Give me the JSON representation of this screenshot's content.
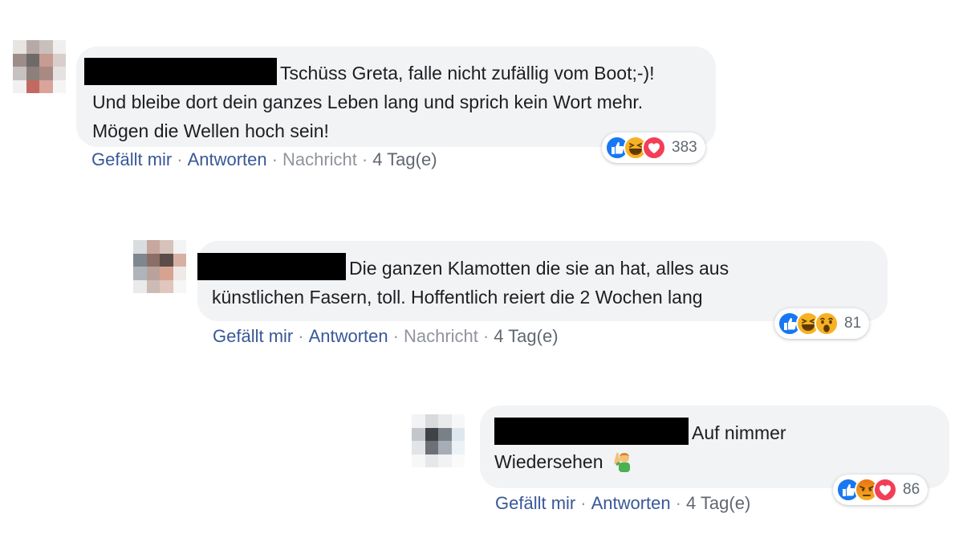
{
  "comments": [
    {
      "text_line1": "Tschüss Greta, falle nicht zufällig vom Boot;-)!",
      "text_line2": "Und bleibe dort dein ganzes Leben lang und sprich kein Wort mehr.",
      "text_line3": "Mögen die Wellen hoch sein!",
      "like": "Gefällt mir",
      "reply": "Antworten",
      "message": "Nachricht",
      "time": "4 Tag(e)",
      "reactions": [
        "like-icon",
        "haha-icon",
        "love-icon"
      ],
      "reaction_count": "383"
    },
    {
      "text_line1": "Die ganzen Klamotten die sie an hat, alles aus",
      "text_line2": "künstlichen Fasern, toll. Hoffentlich reiert die 2 Wochen lang",
      "like": "Gefällt mir",
      "reply": "Antworten",
      "message": "Nachricht",
      "time": "4 Tag(e)",
      "reactions": [
        "like-icon",
        "haha-icon",
        "wow-icon"
      ],
      "reaction_count": "81"
    },
    {
      "text_line1": "Auf nimmer",
      "text_line2": "Wiedersehen",
      "like": "Gefällt mir",
      "reply": "Antworten",
      "time": "4 Tag(e)",
      "reactions": [
        "like-icon",
        "angry-icon",
        "love-icon"
      ],
      "reaction_count": "86"
    }
  ],
  "separator": "·",
  "colors": {
    "bubble": "#f2f3f5",
    "link": "#385898",
    "meta": "#90949c",
    "like": "#1877f2",
    "love": "#f33e58",
    "haha": "#f7b125"
  }
}
